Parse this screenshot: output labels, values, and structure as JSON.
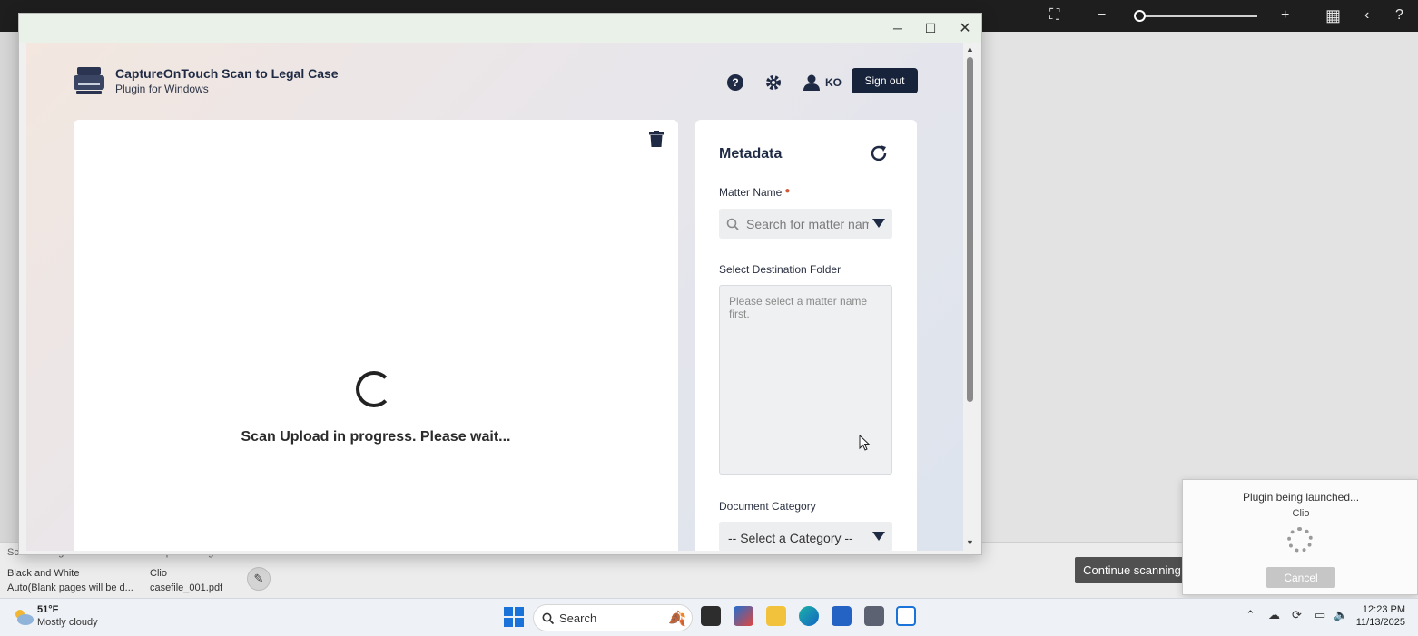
{
  "app": {
    "title": "CaptureOnTouch Scan to Legal Case",
    "subtitle": "Plugin for Windows",
    "user_initials": "KO",
    "sign_out_label": "Sign out"
  },
  "preview": {
    "status_message": "Scan Upload in progress. Please wait..."
  },
  "metadata": {
    "title": "Metadata",
    "matter_name_label": "Matter Name",
    "matter_name_placeholder": "Search for matter name",
    "destination_label": "Select Destination Folder",
    "destination_placeholder": "Please select a matter name first.",
    "category_label": "Document Category",
    "category_value": "-- Select a Category --"
  },
  "host_settings": {
    "scan_settings_header": "Scan Settings",
    "output_settings_header": "Output Settings",
    "color_mode": "Black and White",
    "blank_page": "Auto(Blank pages will be d...",
    "output_target": "Clio",
    "output_file": "casefile_001.pdf",
    "continue_label": "Continue scanning"
  },
  "toast": {
    "title": "Plugin being launched...",
    "subtitle": "Clio",
    "cancel_label": "Cancel"
  },
  "taskbar": {
    "weather_temp": "51°F",
    "weather_desc": "Mostly cloudy",
    "search_label": "Search",
    "time": "12:23 PM",
    "date": "11/13/2025"
  },
  "colors": {
    "accent_navy": "#17223b",
    "required_dot": "#d15a3a"
  }
}
